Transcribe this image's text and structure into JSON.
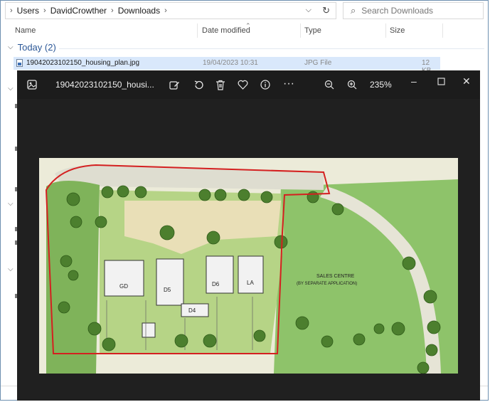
{
  "explorer": {
    "breadcrumbs": [
      "Users",
      "DavidCrowther",
      "Downloads"
    ],
    "search_placeholder": "Search Downloads",
    "columns": [
      "Name",
      "Date modified",
      "Type",
      "Size"
    ],
    "group_label": "Today (2)",
    "file": {
      "name": "19042023102150_housing_plan.jpg",
      "date": "19/04/2023 10:31",
      "type": "JPG File",
      "size": "12 KB"
    }
  },
  "viewer": {
    "title": "19042023102150_housi...",
    "zoom": "235%",
    "colors": {
      "background": "#202020",
      "boundary": "#d42020",
      "grass": "#8cc063"
    }
  },
  "plan": {
    "labels": [
      "GD",
      "D6",
      "LA",
      "D5",
      "D4",
      "SALES CENTRE",
      "(BY SEPARATE APPLICATION)"
    ]
  }
}
